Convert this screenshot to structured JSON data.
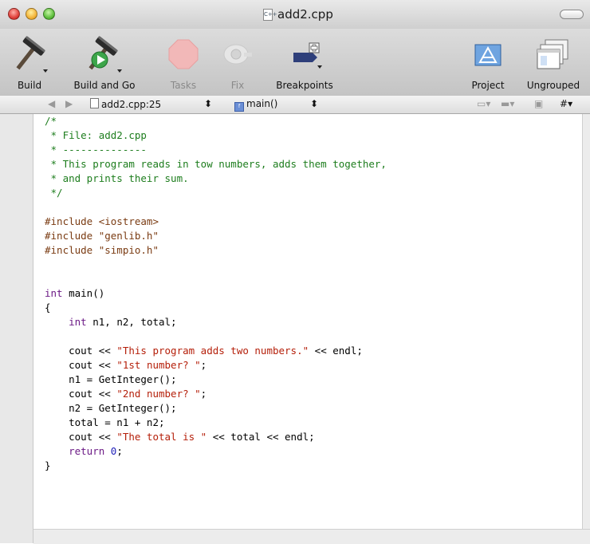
{
  "window": {
    "title": "add2.cpp",
    "file_type_badge": "C++"
  },
  "toolbar": {
    "items": [
      {
        "label": "Build",
        "icon": "hammer-icon",
        "enabled": true
      },
      {
        "label": "Build and Go",
        "icon": "build-and-go-icon",
        "enabled": true
      },
      {
        "label": "Tasks",
        "icon": "stop-sign-icon",
        "enabled": false
      },
      {
        "label": "Fix",
        "icon": "fix-bandage-icon",
        "enabled": false
      },
      {
        "label": "Breakpoints",
        "icon": "breakpoint-icon",
        "enabled": true
      },
      {
        "label": "Project",
        "icon": "project-app-icon",
        "enabled": true
      },
      {
        "label": "Ungrouped",
        "icon": "ungrouped-windows-icon",
        "enabled": true
      }
    ]
  },
  "navbar": {
    "back": "◀",
    "forward": "▶",
    "file": "add2.cpp:25",
    "function": "main()",
    "popup_arrows": "⬍",
    "symbol_menu": "#"
  },
  "code": {
    "lines": [
      [
        {
          "t": "/*",
          "c": "comment"
        }
      ],
      [
        {
          "t": " * File: add2.cpp",
          "c": "comment"
        }
      ],
      [
        {
          "t": " * --------------",
          "c": "comment"
        }
      ],
      [
        {
          "t": " * This program reads in tow numbers, adds them together,",
          "c": "comment"
        }
      ],
      [
        {
          "t": " * and prints their sum.",
          "c": "comment"
        }
      ],
      [
        {
          "t": " */",
          "c": "comment"
        }
      ],
      [],
      [
        {
          "t": "#include <iostream>",
          "c": "pre"
        }
      ],
      [
        {
          "t": "#include \"genlib.h\"",
          "c": "pre"
        }
      ],
      [
        {
          "t": "#include \"simpio.h\"",
          "c": "pre"
        }
      ],
      [],
      [],
      [
        {
          "t": "int",
          "c": "keyword"
        },
        {
          "t": " main()",
          "c": "plain"
        }
      ],
      [
        {
          "t": "{",
          "c": "plain"
        }
      ],
      [
        {
          "t": "    ",
          "c": "plain"
        },
        {
          "t": "int",
          "c": "keyword"
        },
        {
          "t": " n1, n2, total;",
          "c": "plain"
        }
      ],
      [],
      [
        {
          "t": "    cout << ",
          "c": "plain"
        },
        {
          "t": "\"This program adds two numbers.\"",
          "c": "string"
        },
        {
          "t": " << endl;",
          "c": "plain"
        }
      ],
      [
        {
          "t": "    cout << ",
          "c": "plain"
        },
        {
          "t": "\"1st number? \"",
          "c": "string"
        },
        {
          "t": ";",
          "c": "plain"
        }
      ],
      [
        {
          "t": "    n1 = GetInteger();",
          "c": "plain"
        }
      ],
      [
        {
          "t": "    cout << ",
          "c": "plain"
        },
        {
          "t": "\"2nd number? \"",
          "c": "string"
        },
        {
          "t": ";",
          "c": "plain"
        }
      ],
      [
        {
          "t": "    n2 = GetInteger();",
          "c": "plain"
        }
      ],
      [
        {
          "t": "    total = n1 + n2;",
          "c": "plain"
        }
      ],
      [
        {
          "t": "    cout << ",
          "c": "plain"
        },
        {
          "t": "\"The total is \"",
          "c": "string"
        },
        {
          "t": " << total << endl;",
          "c": "plain"
        }
      ],
      [
        {
          "t": "    ",
          "c": "plain"
        },
        {
          "t": "return",
          "c": "keyword"
        },
        {
          "t": " ",
          "c": "plain"
        },
        {
          "t": "0",
          "c": "number"
        },
        {
          "t": ";",
          "c": "plain"
        }
      ],
      [
        {
          "t": "}",
          "c": "plain"
        }
      ]
    ]
  }
}
